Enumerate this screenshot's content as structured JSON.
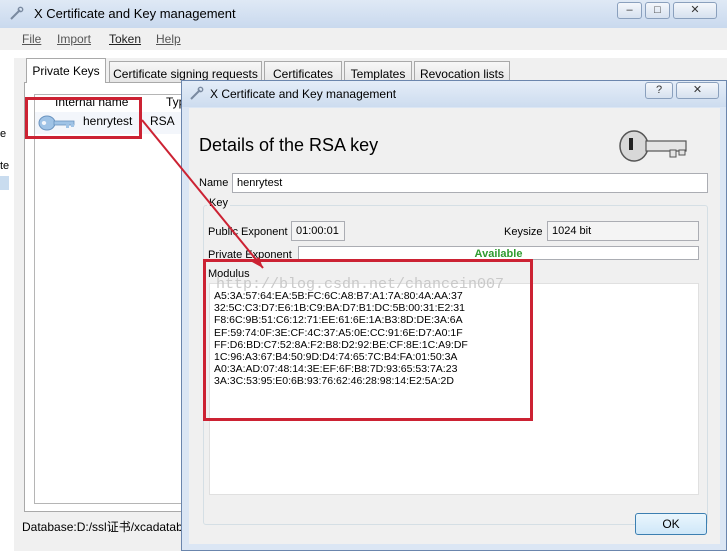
{
  "main_window": {
    "title": "X Certificate and Key management",
    "min_label": "–",
    "max_label": "□",
    "close_label": "✕",
    "menu": [
      "File",
      "Import",
      "Token",
      "Help"
    ],
    "tabs": [
      "Private Keys",
      "Certificate signing requests",
      "Certificates",
      "Templates",
      "Revocation lists"
    ],
    "columns": [
      "Internal name",
      "Typ"
    ],
    "key_row": {
      "name": "henrytest",
      "type": "RSA"
    },
    "left_edge_marks": [
      "e",
      "te"
    ],
    "status": "Database:D:/ssl证书/xcadatab"
  },
  "dialog": {
    "title": "X Certificate and Key management",
    "help_label": "?",
    "close_label": "✕",
    "heading": "Details of the RSA key",
    "name_label": "Name",
    "name_value": "henrytest",
    "group_title": "Key",
    "public_exponent_label": "Public Exponent",
    "public_exponent_value": "01:00:01",
    "keysize_label": "Keysize",
    "keysize_value": "1024 bit",
    "private_exponent_label": "Private Exponent",
    "private_exponent_value": "Available",
    "modulus_label": "Modulus",
    "modulus_lines": [
      "A5:3A:57:64:EA:5B:FC:6C:A8:B7:A1:7A:80:4A:AA:37",
      "32:5C:C3:D7:E6:1B:C9:BA:D7:B1:DC:5B:00:31:E2:31",
      "F8:6C:9B:51:C6:12:71:EE:61:6E:1A:B3:8D:DE:3A:6A",
      "EF:59:74:0F:3E:CF:4C:37:A5:0E:CC:91:6E:D7:A0:1F",
      "FF:D6:BD:C7:52:8A:F2:B8:D2:92:BE:CF:8E:1C:A9:DF",
      "1C:96:A3:67:B4:50:9D:D4:74:65:7C:B4:FA:01:50:3A",
      "A0:3A:AD:07:48:14:3E:EF:6F:B8:7D:93:65:53:7A:23",
      "3A:3C:53:95:E0:6B:93:76:62:46:28:98:14:E2:5A:2D"
    ],
    "ok_label": "OK",
    "watermark": "http://blog.csdn.net/chancein007"
  },
  "colors": {
    "annotation_red": "#cc2233",
    "available_green": "#2e9b2e"
  }
}
